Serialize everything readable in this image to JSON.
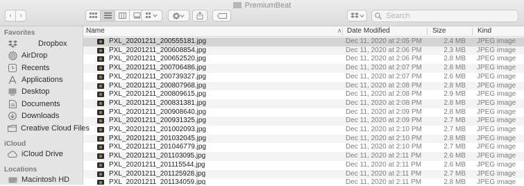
{
  "window": {
    "title": "PremiumBeat"
  },
  "toolbar": {
    "back": "‹",
    "forward": "›",
    "search_placeholder": "Search"
  },
  "sidebar": {
    "favorites_header": "Favorites",
    "favorites": [
      {
        "label": "Dropbox",
        "icon": "dropbox-icon"
      },
      {
        "label": "AirDrop",
        "icon": "airdrop-icon"
      },
      {
        "label": "Recents",
        "icon": "recents-icon"
      },
      {
        "label": "Applications",
        "icon": "applications-icon"
      },
      {
        "label": "Desktop",
        "icon": "desktop-icon"
      },
      {
        "label": "Documents",
        "icon": "documents-icon"
      },
      {
        "label": "Downloads",
        "icon": "downloads-icon"
      },
      {
        "label": "Creative Cloud Files",
        "icon": "folder-icon"
      }
    ],
    "icloud_header": "iCloud",
    "icloud": [
      {
        "label": "iCloud Drive",
        "icon": "icloud-icon"
      }
    ],
    "locations_header": "Locations",
    "locations": [
      {
        "label": "Macintosh HD",
        "icon": "disk-icon"
      }
    ]
  },
  "columns": {
    "name": "Name",
    "date": "Date Modified",
    "size": "Size",
    "kind": "Kind"
  },
  "files": [
    {
      "name": "PXL_20201211_200555181.jpg",
      "date": "Dec 11, 2020 at 2:05 PM",
      "size": "2.4 MB",
      "kind": "JPEG image"
    },
    {
      "name": "PXL_20201211_200608854.jpg",
      "date": "Dec 11, 2020 at 2:06 PM",
      "size": "2.3 MB",
      "kind": "JPEG image"
    },
    {
      "name": "PXL_20201211_200652520.jpg",
      "date": "Dec 11, 2020 at 2:06 PM",
      "size": "2.8 MB",
      "kind": "JPEG image"
    },
    {
      "name": "PXL_20201211_200706486.jpg",
      "date": "Dec 11, 2020 at 2:07 PM",
      "size": "2.8 MB",
      "kind": "JPEG image"
    },
    {
      "name": "PXL_20201211_200739327.jpg",
      "date": "Dec 11, 2020 at 2:07 PM",
      "size": "2.6 MB",
      "kind": "JPEG image"
    },
    {
      "name": "PXL_20201211_200807968.jpg",
      "date": "Dec 11, 2020 at 2:08 PM",
      "size": "2.8 MB",
      "kind": "JPEG image"
    },
    {
      "name": "PXL_20201211_200809615.jpg",
      "date": "Dec 11, 2020 at 2:08 PM",
      "size": "2.9 MB",
      "kind": "JPEG image"
    },
    {
      "name": "PXL_20201211_200831381.jpg",
      "date": "Dec 11, 2020 at 2:08 PM",
      "size": "2.8 MB",
      "kind": "JPEG image"
    },
    {
      "name": "PXL_20201211_200908640.jpg",
      "date": "Dec 11, 2020 at 2:09 PM",
      "size": "2.8 MB",
      "kind": "JPEG image"
    },
    {
      "name": "PXL_20201211_200931325.jpg",
      "date": "Dec 11, 2020 at 2:09 PM",
      "size": "2.7 MB",
      "kind": "JPEG image"
    },
    {
      "name": "PXL_20201211_201002093.jpg",
      "date": "Dec 11, 2020 at 2:10 PM",
      "size": "2.7 MB",
      "kind": "JPEG image"
    },
    {
      "name": "PXL_20201211_201032045.jpg",
      "date": "Dec 11, 2020 at 2:10 PM",
      "size": "2.8 MB",
      "kind": "JPEG image"
    },
    {
      "name": "PXL_20201211_201046779.jpg",
      "date": "Dec 11, 2020 at 2:10 PM",
      "size": "2.7 MB",
      "kind": "JPEG image"
    },
    {
      "name": "PXL_20201211_201103095.jpg",
      "date": "Dec 11, 2020 at 2:11 PM",
      "size": "2.6 MB",
      "kind": "JPEG image"
    },
    {
      "name": "PXL_20201211_201115544.jpg",
      "date": "Dec 11, 2020 at 2:11 PM",
      "size": "2.6 MB",
      "kind": "JPEG image"
    },
    {
      "name": "PXL_20201211_201125928.jpg",
      "date": "Dec 11, 2020 at 2:11 PM",
      "size": "2.7 MB",
      "kind": "JPEG image"
    },
    {
      "name": "PXL_20201211_201134059.jpg",
      "date": "Dec 11, 2020 at 2:11 PM",
      "size": "2.8 MB",
      "kind": "JPEG image"
    }
  ]
}
